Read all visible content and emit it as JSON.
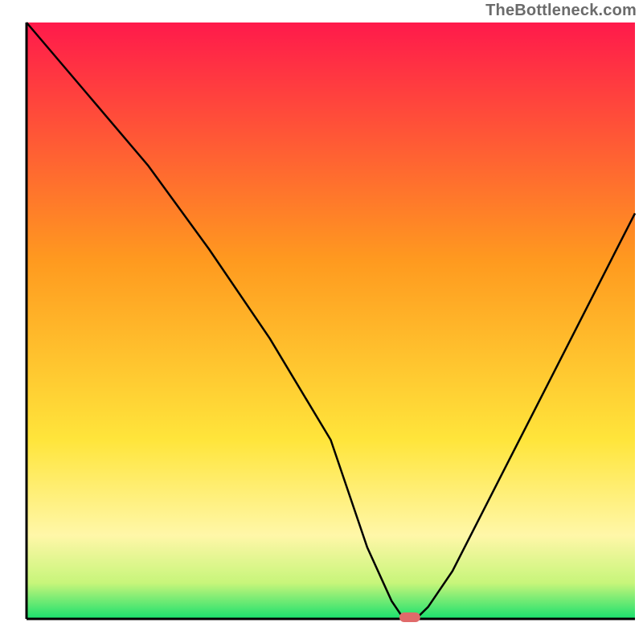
{
  "watermark": "TheBottleneck.com",
  "chart_data": {
    "type": "line",
    "title": "",
    "xlabel": "",
    "ylabel": "",
    "xlim": [
      0,
      100
    ],
    "ylim": [
      0,
      100
    ],
    "x": [
      0,
      10,
      20,
      30,
      40,
      50,
      56,
      60,
      62,
      64,
      66,
      70,
      80,
      90,
      100
    ],
    "values": [
      100,
      88,
      76,
      62,
      47,
      30,
      12,
      3,
      0,
      0,
      2,
      8,
      28,
      48,
      68
    ],
    "minimum_marker": {
      "x": 63,
      "y": 0
    },
    "gradient_stops": [
      {
        "pct": 0,
        "color": "#ff1a4b"
      },
      {
        "pct": 40,
        "color": "#ff9a1f"
      },
      {
        "pct": 70,
        "color": "#ffe53b"
      },
      {
        "pct": 86,
        "color": "#fff7a8"
      },
      {
        "pct": 94,
        "color": "#c7f57a"
      },
      {
        "pct": 100,
        "color": "#18e06e"
      }
    ],
    "axis_color": "#000000",
    "curve_color": "#000000",
    "marker_color": "#e06a6a"
  }
}
